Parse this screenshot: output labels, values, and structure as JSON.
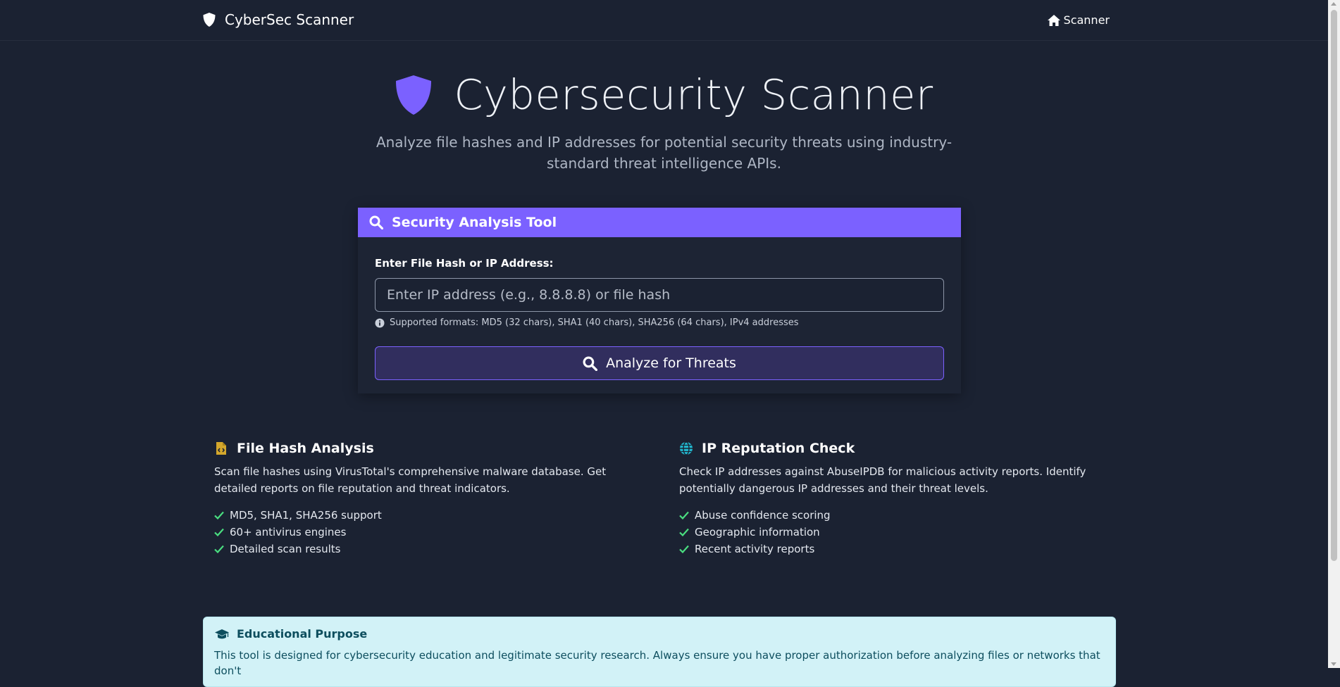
{
  "nav": {
    "brand": "CyberSec Scanner",
    "home_link": "Scanner"
  },
  "hero": {
    "title": "Cybersecurity Scanner",
    "subtitle": "Analyze file hashes and IP addresses for potential security threats using industry-standard threat intelligence APIs."
  },
  "tool": {
    "header": "Security Analysis Tool",
    "input_label": "Enter File Hash or IP Address:",
    "input_value": "",
    "input_placeholder": "Enter IP address (e.g., 8.8.8.8) or file hash",
    "help_text": "Supported formats: MD5 (32 chars), SHA1 (40 chars), SHA256 (64 chars), IPv4 addresses",
    "submit_label": "Analyze for Threats"
  },
  "features": {
    "hash": {
      "title": "File Hash Analysis",
      "description": "Scan file hashes using VirusTotal's comprehensive malware database. Get detailed reports on file reputation and threat indicators.",
      "items": [
        "MD5, SHA1, SHA256 support",
        "60+ antivirus engines",
        "Detailed scan results"
      ]
    },
    "ip": {
      "title": "IP Reputation Check",
      "description": "Check IP addresses against AbuseIPDB for malicious activity reports. Identify potentially dangerous IP addresses and their threat levels.",
      "items": [
        "Abuse confidence scoring",
        "Geographic information",
        "Recent activity reports"
      ]
    }
  },
  "notice": {
    "title": "Educational Purpose",
    "text": "This tool is designed for cybersecurity education and legitimate security research. Always ensure you have proper authorization before analyzing files or networks that don't"
  },
  "colors": {
    "background": "#1b2232",
    "accent": "#7b61ff",
    "check": "#4ade80",
    "hash_icon": "#d4a72c",
    "globe_icon": "#22b8cf",
    "notice_bg": "#d2f2f7"
  },
  "icons": {
    "brand": "shield-icon",
    "home": "home-icon",
    "hero": "shield-icon",
    "tool_header": "search-icon",
    "help": "info-icon",
    "submit": "search-icon",
    "hash_feature": "file-code-icon",
    "ip_feature": "globe-icon",
    "list_item": "check-icon",
    "notice": "graduation-cap-icon"
  }
}
